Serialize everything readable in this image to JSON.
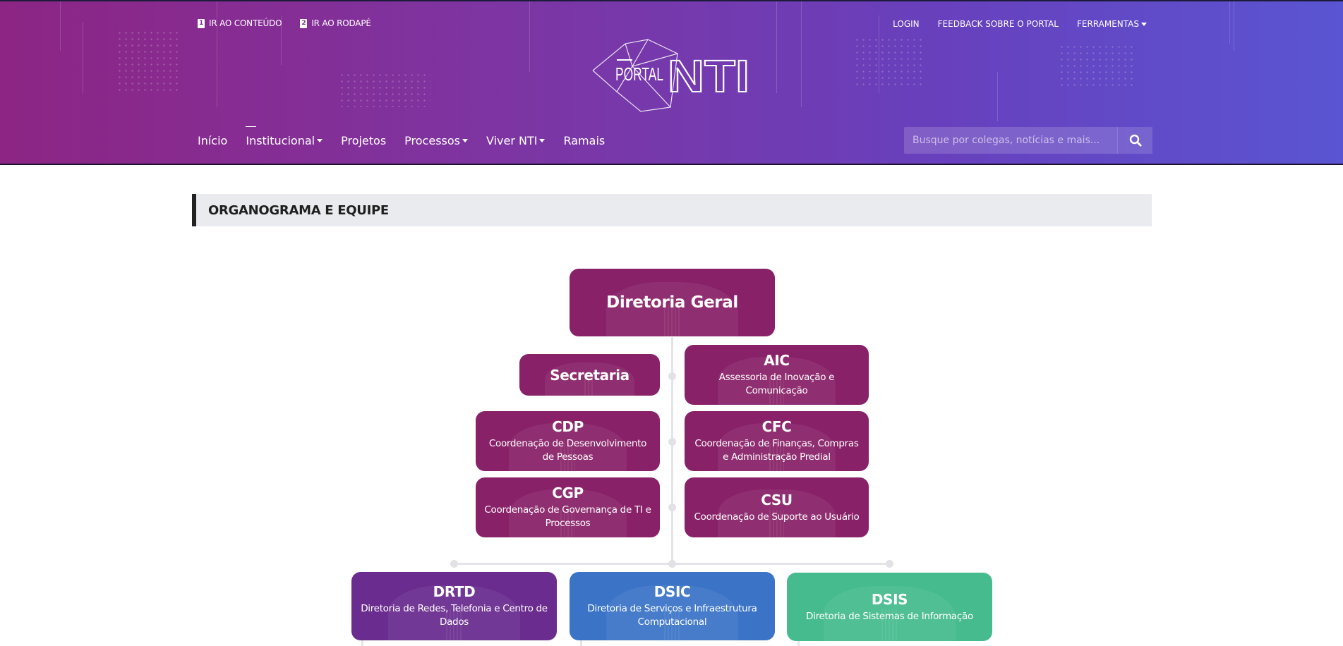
{
  "header": {
    "skip_links": [
      {
        "num": "1",
        "label": "IR AO CONTEÚDO"
      },
      {
        "num": "2",
        "label": "IR AO RODAPÉ"
      }
    ],
    "util_links": {
      "login": "LOGIN",
      "feedback": "FEEDBACK SOBRE O PORTAL",
      "tools": "FERRAMENTAS"
    },
    "logo": {
      "portal": "PORTAL",
      "brand": "NTI"
    },
    "nav": [
      "Início",
      "Institucional",
      "Projetos",
      "Processos",
      "Viver NTI",
      "Ramais"
    ],
    "search": {
      "placeholder": "Busque por colegas, notícias e mais..."
    }
  },
  "page": {
    "section_title": "ORGANOGRAMA E EQUIPE"
  },
  "org": {
    "top": {
      "title": "Diretoria Geral"
    },
    "secretaria": {
      "title": "Secretaria"
    },
    "aic": {
      "title": "AIC",
      "desc": "Assessoria de Inovação e Comunicação"
    },
    "cdp": {
      "title": "CDP",
      "desc": "Coordenação de Desenvolvimento de Pessoas"
    },
    "cfc": {
      "title": "CFC",
      "desc": "Coordenação de Finanças, Compras e Administração Predial"
    },
    "cgp": {
      "title": "CGP",
      "desc": "Coordenação de Governança de TI e Processos"
    },
    "csu": {
      "title": "CSU",
      "desc": "Coordenação de Suporte ao Usuário"
    },
    "drtd": {
      "title": "DRTD",
      "desc": "Diretoria de Redes, Telefonia e Centro de Dados"
    },
    "dsic": {
      "title": "DSIC",
      "desc": "Diretoria de Serviços e Infraestrutura Computacional"
    },
    "dsis": {
      "title": "DSIS",
      "desc": "Diretoria de Sistemas de Informação"
    }
  },
  "colors": {
    "header_start": "#8d2584",
    "header_end": "#5a55d2",
    "org_purple": "#882168",
    "drtd": "#6a2c8f",
    "dsic": "#3b74c7",
    "dsis": "#46bb8e"
  }
}
